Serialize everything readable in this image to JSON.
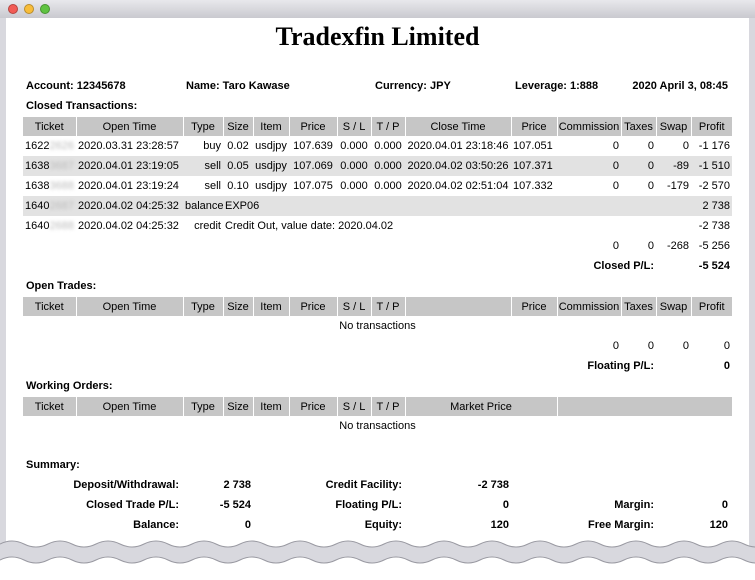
{
  "company": "Tradexfin Limited",
  "header": {
    "account": "Account: 12345678",
    "name": "Name: Taro Kawase",
    "currency": "Currency: JPY",
    "leverage": "Leverage: 1:888",
    "datetime": "2020 April 3, 08:45"
  },
  "closed": {
    "label": "Closed Transactions:",
    "columns": [
      "Ticket",
      "Open Time",
      "Type",
      "Size",
      "Item",
      "Price",
      "S / L",
      "T / P",
      "Close Time",
      "Price",
      "Commission",
      "Taxes",
      "Swap",
      "Profit"
    ],
    "rows": [
      {
        "ticket": "1622",
        "mask": "2626",
        "open": "2020.03.31 23:28:57",
        "type": "buy",
        "size": "0.02",
        "item": "usdjpy",
        "price": "107.639",
        "sl": "0.000",
        "tp": "0.000",
        "close": "2020.04.01 23:18:46",
        "cprice": "107.051",
        "comm": "0",
        "tax": "0",
        "swap": "0",
        "profit": "-1 176"
      },
      {
        "ticket": "1638",
        "mask": "3687",
        "open": "2020.04.01 23:19:05",
        "type": "sell",
        "size": "0.05",
        "item": "usdjpy",
        "price": "107.069",
        "sl": "0.000",
        "tp": "0.000",
        "close": "2020.04.02 03:50:26",
        "cprice": "107.371",
        "comm": "0",
        "tax": "0",
        "swap": "-89",
        "profit": "-1 510"
      },
      {
        "ticket": "1638",
        "mask": "3688",
        "open": "2020.04.01 23:19:24",
        "type": "sell",
        "size": "0.10",
        "item": "usdjpy",
        "price": "107.075",
        "sl": "0.000",
        "tp": "0.000",
        "close": "2020.04.02 02:51:04",
        "cprice": "107.332",
        "comm": "0",
        "tax": "0",
        "swap": "-179",
        "profit": "-2 570"
      }
    ],
    "balance_row": {
      "ticket": "1640",
      "mask": "2687",
      "open": "2020.04.02 04:25:32",
      "type": "balance",
      "comment": "EXP06",
      "profit": "2 738"
    },
    "credit_row": {
      "ticket": "1640",
      "mask": "2688",
      "open": "2020.04.02 04:25:32",
      "type": "credit",
      "comment": "Credit Out, value date: 2020.04.02",
      "profit": "-2 738"
    },
    "totals": {
      "comm": "0",
      "tax": "0",
      "swap": "-268",
      "profit": "-5 256"
    },
    "pl_label": "Closed P/L:",
    "pl_value": "-5 524"
  },
  "open": {
    "label": "Open Trades:",
    "columns": [
      "Ticket",
      "Open Time",
      "Type",
      "Size",
      "Item",
      "Price",
      "S / L",
      "T / P",
      "",
      "Price",
      "Commission",
      "Taxes",
      "Swap",
      "Profit"
    ],
    "empty": "No transactions",
    "totals": {
      "comm": "0",
      "tax": "0",
      "swap": "0",
      "profit": "0"
    },
    "pl_label": "Floating P/L:",
    "pl_value": "0"
  },
  "working": {
    "label": "Working Orders:",
    "columns": [
      "Ticket",
      "Open Time",
      "Type",
      "Size",
      "Item",
      "Price",
      "S / L",
      "T / P",
      "Market Price",
      ""
    ],
    "empty": "No transactions"
  },
  "summary": {
    "label": "Summary:",
    "deposit_label": "Deposit/Withdrawal:",
    "deposit": "2 738",
    "credit_label": "Credit Facility:",
    "credit": "-2 738",
    "closed_label": "Closed Trade P/L:",
    "closed": "-5 524",
    "floating_label": "Floating P/L:",
    "floating": "0",
    "margin_label": "Margin:",
    "margin": "0",
    "balance_label": "Balance:",
    "balance": "0",
    "equity_label": "Equity:",
    "equity": "120",
    "free_label": "Free Margin:",
    "free": "120"
  }
}
